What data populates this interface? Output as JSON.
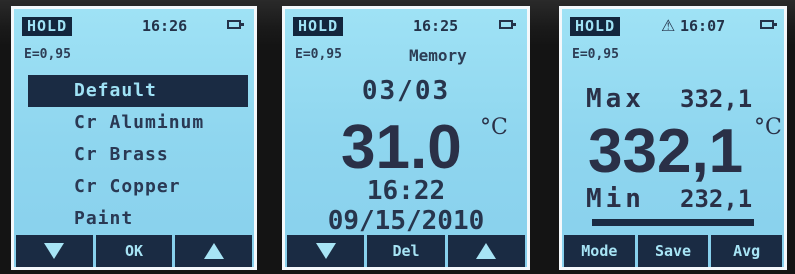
{
  "screen1": {
    "hold": "HOLD",
    "time": "16:26",
    "emissivity": "E=0,95",
    "menu": [
      "Default",
      "Cr Aluminum",
      "Cr Brass",
      "Cr Copper",
      "Paint"
    ],
    "selected_index": 0,
    "softkeys": [
      {
        "icon": "triangle-down-icon",
        "label": ""
      },
      {
        "icon": "",
        "label": "OK"
      },
      {
        "icon": "triangle-up-icon",
        "label": ""
      }
    ]
  },
  "screen2": {
    "hold": "HOLD",
    "time": "16:25",
    "emissivity": "E=0,95",
    "title": "Memory",
    "record": "03/03",
    "reading": "31.0",
    "unit": "°C",
    "clock": "16:22",
    "date": "09/15/2010",
    "softkeys": [
      {
        "icon": "triangle-down-icon",
        "label": ""
      },
      {
        "icon": "",
        "label": "Del"
      },
      {
        "icon": "triangle-up-icon",
        "label": ""
      }
    ]
  },
  "screen3": {
    "hold": "HOLD",
    "warning_icon": "⚠",
    "time": "16:07",
    "emissivity": "E=0,95",
    "max_label": "Max",
    "max_value": "332,1",
    "reading": "332,1",
    "unit": "°C",
    "min_label": "Min",
    "min_value": "232,1",
    "softkeys": [
      "Mode",
      "Save",
      "Avg"
    ]
  }
}
